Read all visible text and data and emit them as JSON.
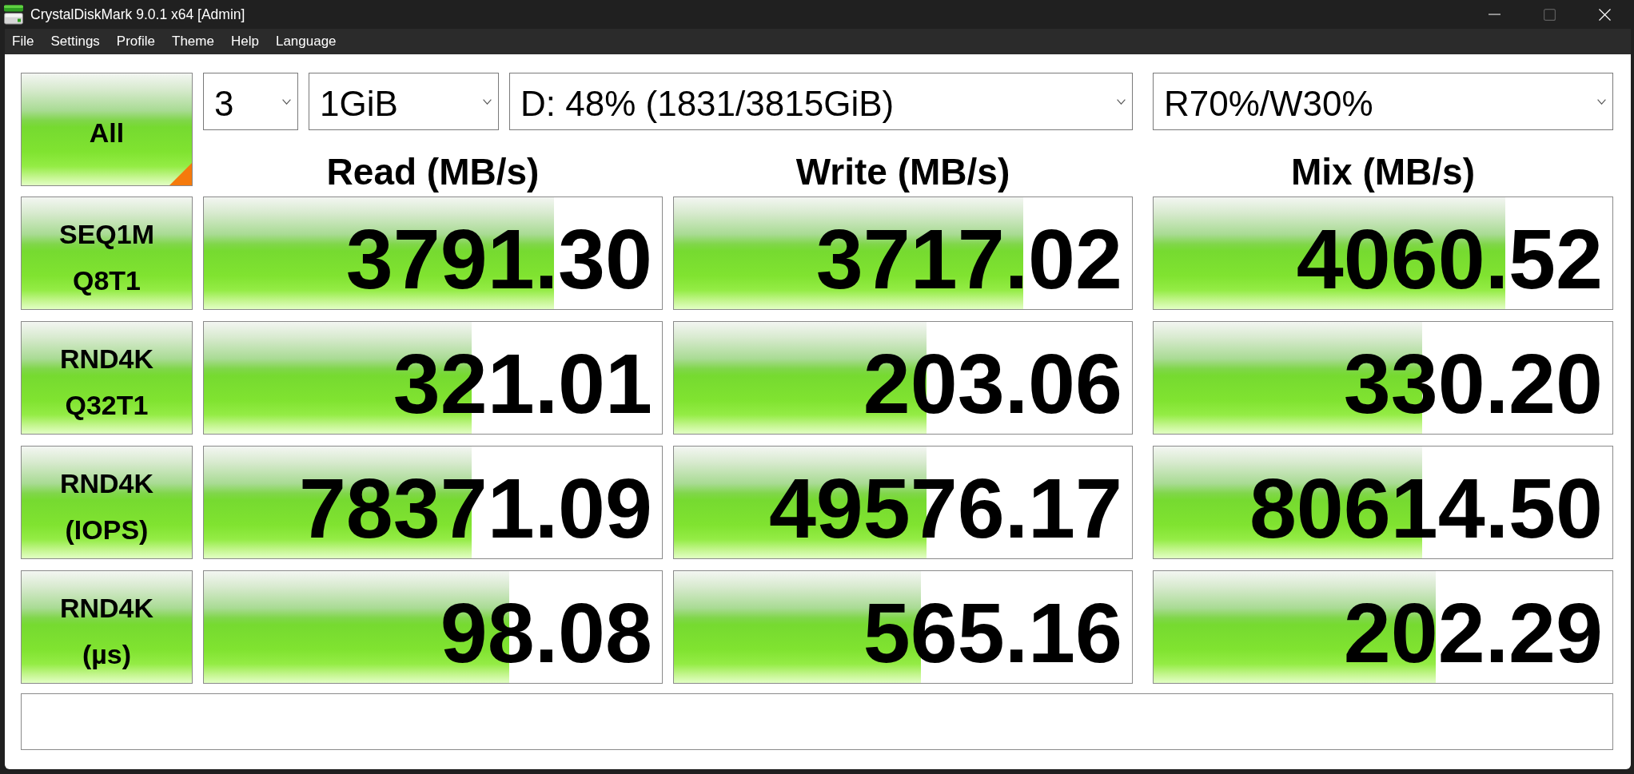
{
  "window": {
    "title": "CrystalDiskMark 9.0.1 x64 [Admin]",
    "maximize_button": {
      "disabled": true
    }
  },
  "menu": [
    "File",
    "Settings",
    "Profile",
    "Theme",
    "Help",
    "Language"
  ],
  "toolbar": {
    "all_button": "All",
    "count": "3",
    "size": "1GiB",
    "drive": "D: 48% (1831/3815GiB)",
    "mix_ratio": "R70%/W30%"
  },
  "columns": [
    "Read (MB/s)",
    "Write (MB/s)",
    "Mix (MB/s)"
  ],
  "tests": [
    {
      "label": [
        "SEQ1M",
        "Q8T1"
      ],
      "results": [
        {
          "value": "3791.30",
          "level": 0.764
        },
        {
          "value": "3717.02",
          "level": 0.762
        },
        {
          "value": "4060.52",
          "level": 0.767
        }
      ]
    },
    {
      "label": [
        "RND4K",
        "Q32T1"
      ],
      "results": [
        {
          "value": "321.01",
          "level": 0.585
        },
        {
          "value": "203.06",
          "level": 0.551
        },
        {
          "value": "330.20",
          "level": 0.586
        }
      ]
    },
    {
      "label": [
        "RND4K",
        "(IOPS)"
      ],
      "results": [
        {
          "value": "78371.09",
          "level": 0.585
        },
        {
          "value": "49576.17",
          "level": 0.551
        },
        {
          "value": "80614.50",
          "level": 0.586
        }
      ]
    },
    {
      "label": [
        "RND4K",
        "(µs)"
      ],
      "results": [
        {
          "value": "98.08",
          "level": 0.667
        },
        {
          "value": "565.16",
          "level": 0.54
        },
        {
          "value": "202.29",
          "level": 0.615
        }
      ]
    }
  ]
}
